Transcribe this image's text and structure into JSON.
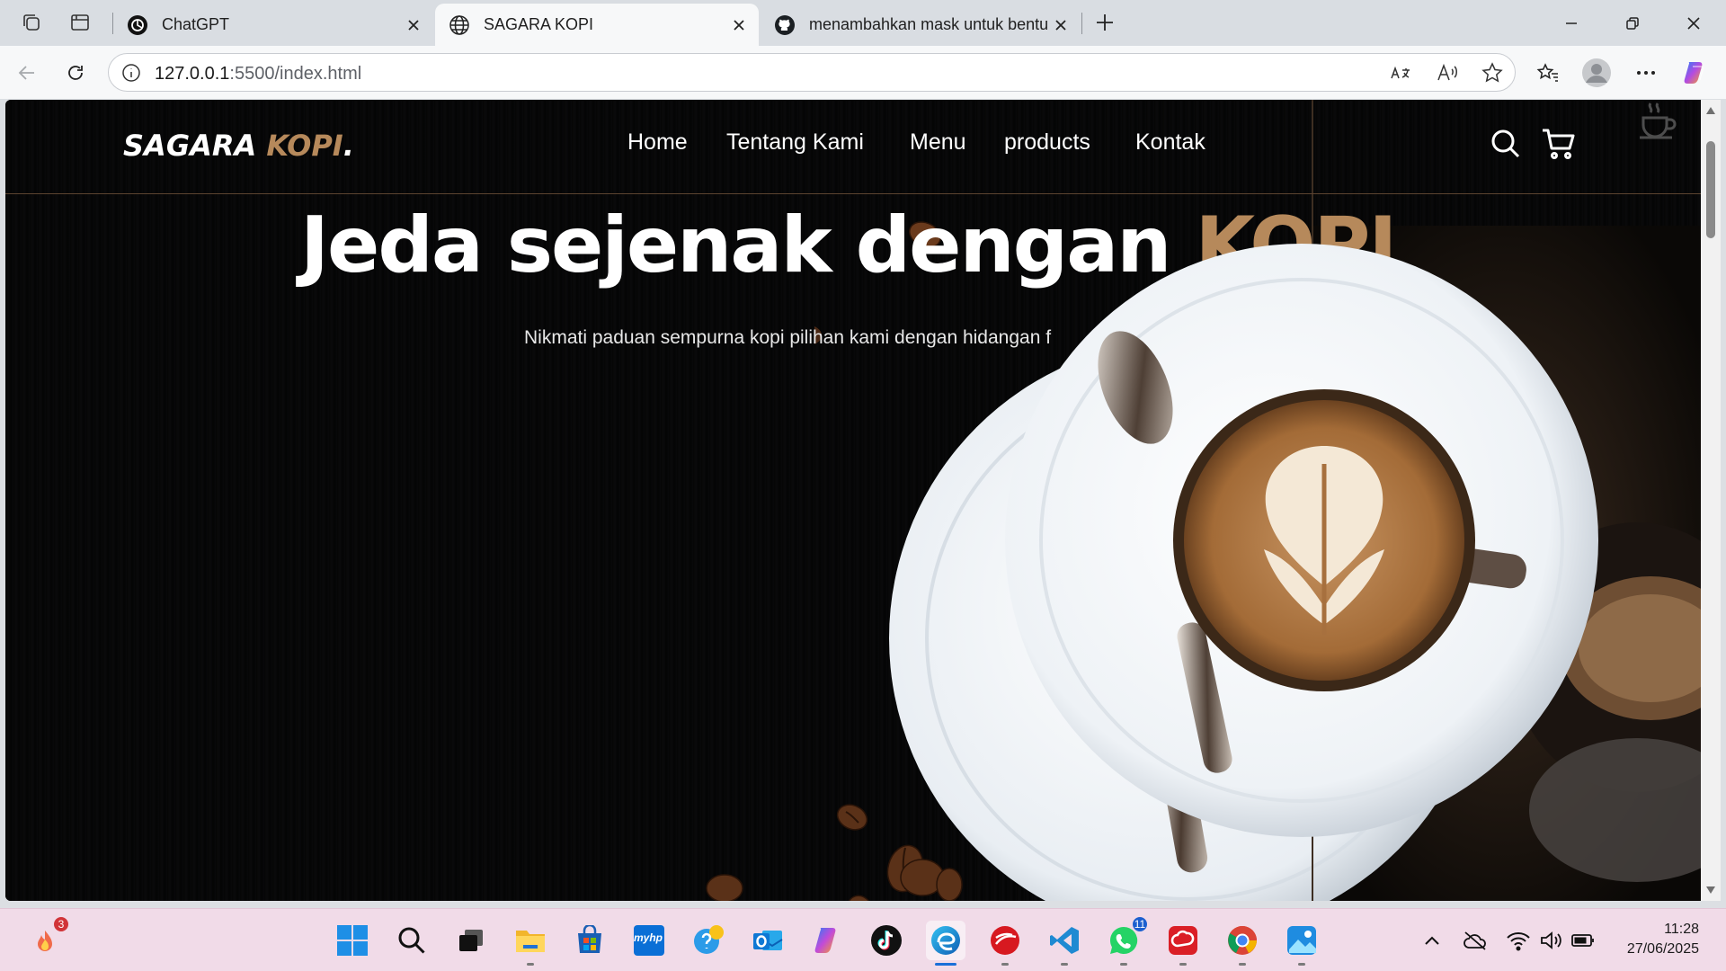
{
  "tabs": [
    {
      "title": "ChatGPT",
      "icon": "chatgpt-icon",
      "active": false
    },
    {
      "title": "SAGARA KOPI",
      "icon": "globe-icon",
      "active": true
    },
    {
      "title": "menambahkan mask untuk bentu",
      "icon": "github-icon",
      "active": false
    }
  ],
  "address_bar": {
    "host": "127.0.0.1",
    "rest": ":5500/index.html"
  },
  "site": {
    "logo_main": "SAGARA ",
    "logo_accent": "KOPI",
    "logo_dot": ".",
    "nav": [
      "Home",
      "Tentang Kami",
      "Menu",
      "products",
      "Kontak"
    ],
    "headline_main": "Jeda sejenak dengan ",
    "headline_accent": "KOPI",
    "subline": "Nikmati paduan sempurna kopi pilihan kami dengan hidangan f"
  },
  "accent_color": "#b6895b",
  "taskbar": {
    "weather_badge": "3",
    "whatsapp_badge": "11",
    "time": "11:28",
    "date": "27/06/2025",
    "myhp_label": "myhp"
  }
}
